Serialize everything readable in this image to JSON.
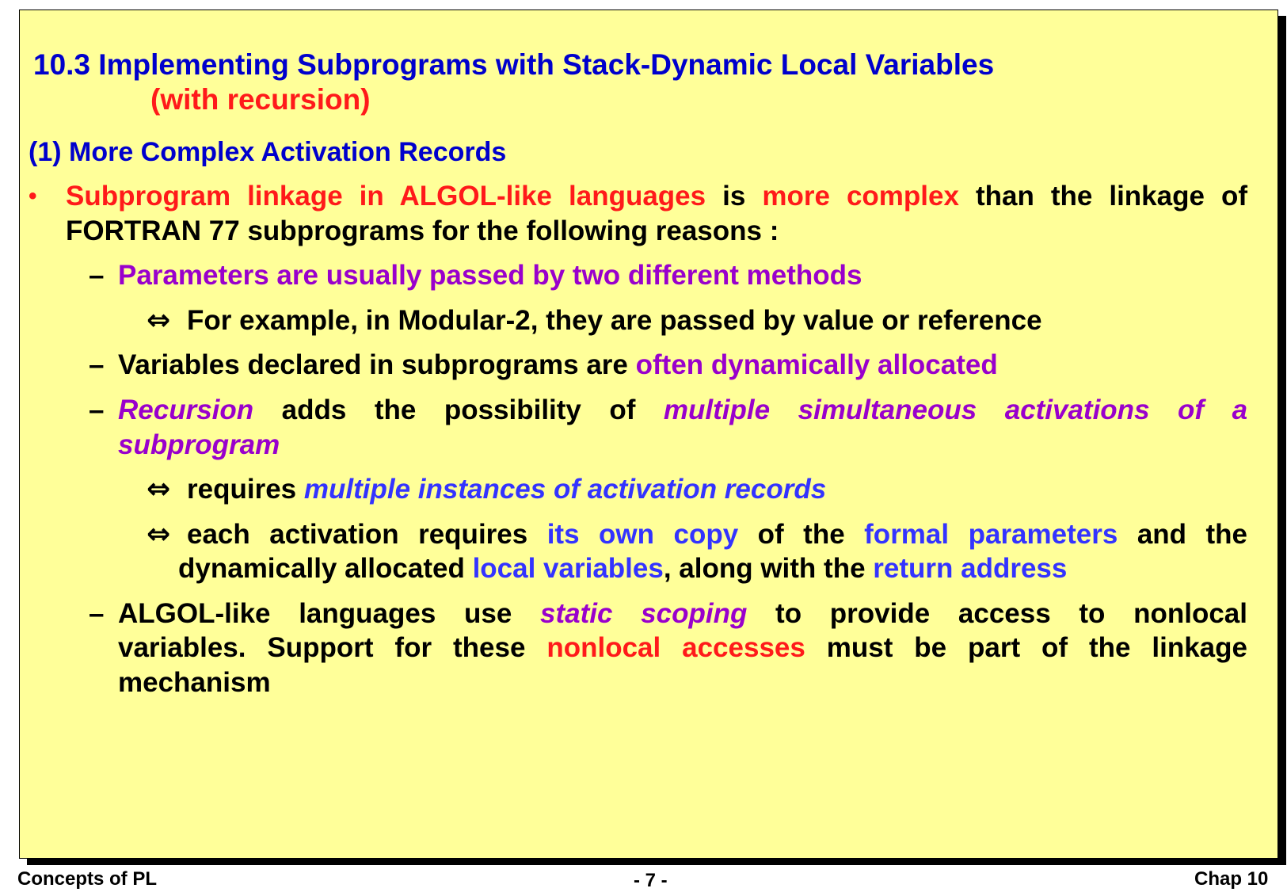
{
  "title": {
    "line1": "10.3 Implementing Subprograms with Stack-Dynamic Local Variables",
    "line2": "(with recursion)"
  },
  "subheading": "(1) More Complex Activation Records",
  "bullet": {
    "marker": "•",
    "part1_red": "Subprogram linkage in ALGOL-like languages",
    "part2": "is",
    "part3_red": "more complex",
    "part4": "than the linkage of",
    "line2": "FORTRAN 77 subprograms for the following reasons :"
  },
  "dash_marker": "–",
  "arrow_marker": "⇔",
  "item1": {
    "text": "Parameters are usually passed by two different methods",
    "sub": "For example, in Modular-2, they are passed by value or reference"
  },
  "item2": {
    "text": "Variables declared in subprograms are",
    "highlight": "often dynamically allocated"
  },
  "item3": {
    "w1": "Recursion",
    "w2": "adds",
    "w3": "the",
    "w4": "possibility",
    "w5": "of",
    "w6": "multiple",
    "w7": "simultaneous",
    "w8": "activations",
    "w9": "of",
    "w10": "a",
    "line2": "subprogram",
    "sub1_text": "requires",
    "sub1_highlight": "multiple instances of activation records",
    "sub2_a": "each activation requires",
    "sub2_b": "its own copy",
    "sub2_c": "of the",
    "sub2_d": "formal parameters",
    "sub2_e": "and the",
    "sub2_f": "dynamically allocated",
    "sub2_g": "local variables",
    "sub2_h": ", along with the",
    "sub2_i": "return address"
  },
  "item4": {
    "a": "ALGOL-like languages use",
    "b": "static scoping",
    "c": "to provide access to nonlocal",
    "d": "variables. Support for these",
    "e": "nonlocal accesses",
    "f": "must be part of the linkage",
    "g": "mechanism"
  },
  "footer": {
    "left": "Concepts of PL",
    "center": "- 7 -",
    "right": "Chap 10"
  },
  "colors": {
    "background": "#ffff99",
    "title_blue": "#0000cc",
    "emphasis_red": "#ff1a1a",
    "purple": "#9900cc",
    "light_blue": "#3333ff"
  }
}
